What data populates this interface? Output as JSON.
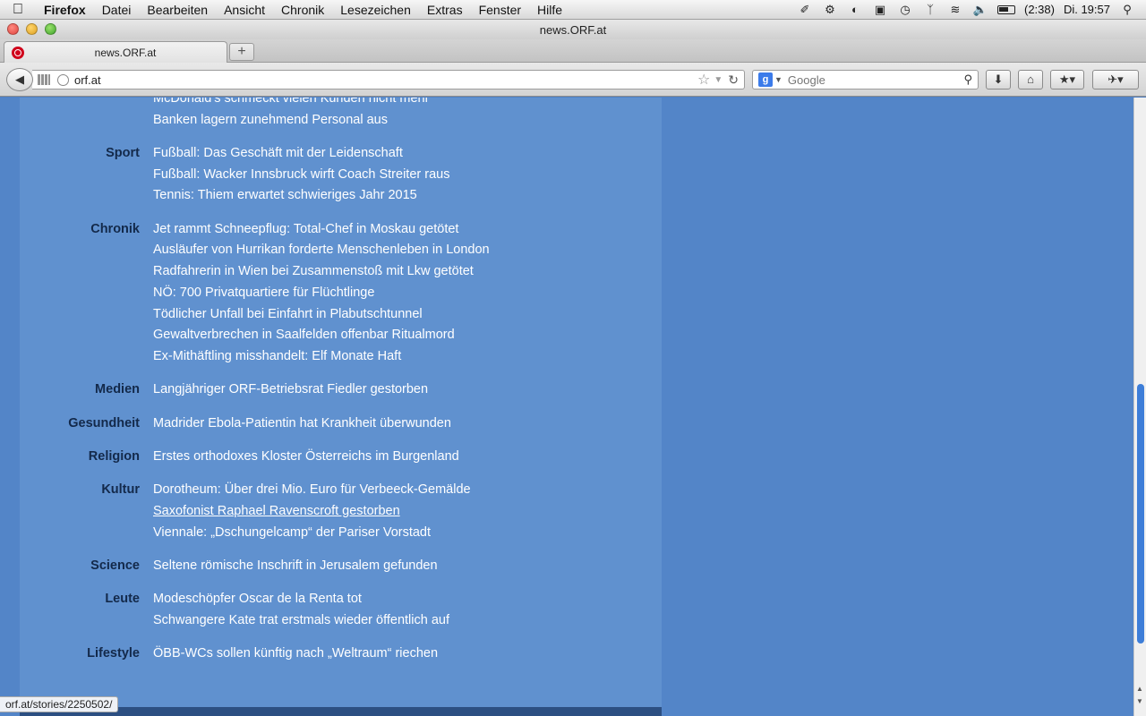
{
  "menubar": {
    "app": "Firefox",
    "items": [
      "Datei",
      "Bearbeiten",
      "Ansicht",
      "Chronik",
      "Lesezeichen",
      "Extras",
      "Fenster",
      "Hilfe"
    ],
    "battery_time": "(2:38)",
    "clock": "Di. 19:57"
  },
  "window": {
    "title": "news.ORF.at"
  },
  "tab": {
    "title": "news.ORF.at",
    "new_tab": "+"
  },
  "navbar": {
    "url": "orf.at",
    "search_placeholder": "Google"
  },
  "sections": [
    {
      "category": "",
      "items": [
        "McDonald’s schmeckt vielen Kunden nicht mehr",
        "Banken lagern zunehmend Personal aus"
      ]
    },
    {
      "category": "Sport",
      "items": [
        "Fußball: Das Geschäft mit der Leidenschaft",
        "Fußball: Wacker Innsbruck wirft Coach Streiter raus",
        "Tennis: Thiem erwartet schwieriges Jahr 2015"
      ]
    },
    {
      "category": "Chronik",
      "items": [
        "Jet rammt Schneepflug: Total-Chef in Moskau getötet",
        "Ausläufer von Hurrikan forderte Menschenleben in London",
        "Radfahrerin in Wien bei Zusammenstoß mit Lkw getötet",
        "NÖ: 700 Privatquartiere für Flüchtlinge",
        "Tödlicher Unfall bei Einfahrt in Plabutschtunnel",
        "Gewaltverbrechen in Saalfelden offenbar Ritualmord",
        "Ex-Mithäftling misshandelt: Elf Monate Haft"
      ]
    },
    {
      "category": "Medien",
      "items": [
        "Langjähriger ORF-Betriebsrat Fiedler gestorben"
      ]
    },
    {
      "category": "Gesundheit",
      "items": [
        "Madrider Ebola-Patientin hat Krankheit überwunden"
      ]
    },
    {
      "category": "Religion",
      "items": [
        "Erstes orthodoxes Kloster Österreichs im Burgenland"
      ]
    },
    {
      "category": "Kultur",
      "items": [
        "Dorotheum: Über drei Mio. Euro für Verbeeck-Gemälde",
        "Saxofonist Raphael Ravenscroft gestorben",
        "Viennale: „Dschungelcamp“ der Pariser Vorstadt"
      ]
    },
    {
      "category": "Science",
      "items": [
        "Seltene römische Inschrift in Jerusalem gefunden"
      ]
    },
    {
      "category": "Leute",
      "items": [
        "Modeschöpfer Oscar de la Renta tot",
        "Schwangere Kate trat erstmals wieder öffentlich auf"
      ]
    },
    {
      "category": "Lifestyle",
      "items": [
        "ÖBB-WCs sollen künftig nach „Weltraum“ riechen"
      ]
    }
  ],
  "hovered_item": "Saxofonist Raphael Ravenscroft gestorben",
  "statusbar": {
    "link": "orf.at/stories/2250502/"
  },
  "colors": {
    "page_bg": "#5385c8",
    "column_bg": "#6091cf",
    "category_text": "#13294a",
    "link_text": "#ffffff"
  }
}
